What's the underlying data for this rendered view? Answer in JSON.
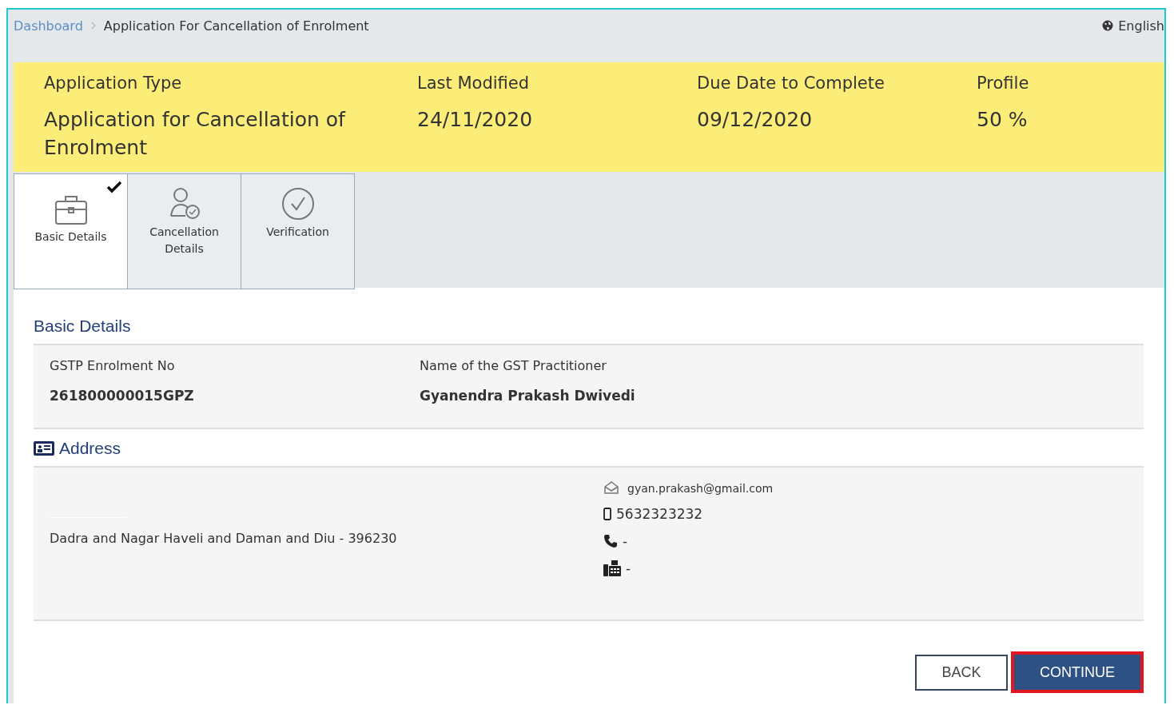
{
  "breadcrumb": [
    {
      "label": "Dashboard",
      "kind": "link"
    },
    {
      "label": "Application For Cancellation of Enrolment",
      "kind": "current"
    }
  ],
  "language": "English",
  "summary": [
    {
      "label": "Application Type",
      "value": "Application for Cancellation of Enrolment"
    },
    {
      "label": "Last Modified",
      "value": "24/11/2020"
    },
    {
      "label": "Due Date to Complete",
      "value": "09/12/2020"
    },
    {
      "label": "Profile",
      "value": "50 %"
    }
  ],
  "tabs": [
    {
      "label": "Basic Details",
      "kind": "briefcase",
      "selected": true,
      "completed": true
    },
    {
      "label": "Cancellation Details",
      "kind": "person",
      "selected": false,
      "completed": false
    },
    {
      "label": "Verification",
      "kind": "check",
      "selected": false,
      "completed": false
    }
  ],
  "section_title": "Basic Details",
  "fields": [
    {
      "label": "GSTP Enrolment No",
      "value": "261800000015GPZ"
    },
    {
      "label": "Name of the GST Practitioner",
      "value": "Gyanendra Prakash Dwivedi"
    }
  ],
  "address": {
    "title": "Address",
    "text": "Dadra and Nagar Haveli and Daman and Diu - 396230",
    "contacts": [
      {
        "kind": "email",
        "value": "gyan.prakash@gmail.com"
      },
      {
        "kind": "mobile",
        "value": "5632323232"
      },
      {
        "kind": "phone",
        "value": "-"
      },
      {
        "kind": "fax",
        "value": "-"
      }
    ]
  },
  "buttons": [
    {
      "label": "BACK",
      "kind": "secondary",
      "highlighted": false
    },
    {
      "label": "CONTINUE",
      "kind": "primary",
      "highlighted": true
    }
  ]
}
